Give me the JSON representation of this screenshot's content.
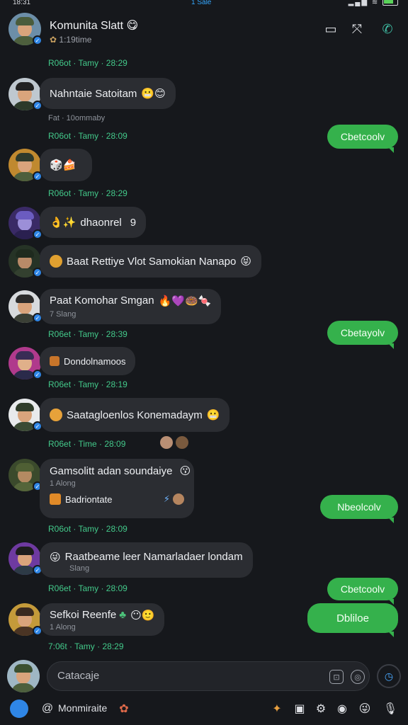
{
  "status_bar": {
    "time": "18:31",
    "center": "1 Sale"
  },
  "header": {
    "title": "Komunita Slatt",
    "title_emoji": "😋",
    "subtitle": "1:19time"
  },
  "messages": [
    {
      "meta": "R06ot · Tamy · 28:29"
    },
    {
      "text": "Nahntaie Satoitam",
      "emoji": "😬😊",
      "sub": "Fat · 10ommaby",
      "meta": "R06ot · Tamy · 28:09"
    },
    {
      "text": "",
      "emoji": "🎲🍰",
      "meta": "R06ot · Tamy · 28:29"
    },
    {
      "text": "dhaonrel",
      "emoji": "👌✨",
      "trail": "9"
    },
    {
      "text": "Baat Rettiye Vlot Samokian Nanapo",
      "emoji": "😝"
    },
    {
      "text": "Paat Komohar Smgan",
      "emoji": "🔥💜🍩🍬",
      "sub": "7 Slang",
      "meta": "R06et · Tamy · 28:39"
    },
    {
      "text": "Dondolnamoos",
      "meta": "R06et · Tamy · 28:19"
    },
    {
      "text": "Saatagloenlos Konemadaym",
      "emoji": "😬",
      "meta": "R06et · Time · 28:09"
    },
    {
      "text": "Gamsolitt adan soundaiye",
      "emoji": "😗",
      "sub": "1 Along",
      "line2": "Badriontate",
      "meta": "R06ot · Tamy · 28:09"
    },
    {
      "text": "Raatbeame leer Namarladaer londam",
      "emoji": "😜",
      "sub": "Slang",
      "meta": "R06et · Tamy · 28:09"
    },
    {
      "text": "Sefkoi Reenfe",
      "emoji": "😶🙂",
      "sub": "1 Along",
      "meta": "7:06t · Tamy · 28:29"
    }
  ],
  "outgoing": [
    {
      "text": "Cbetcoolv"
    },
    {
      "text": "Cbetayolv"
    },
    {
      "text": "Nbeolcolv"
    },
    {
      "text": "Cbetcoolv"
    },
    {
      "text": "Dbliloe"
    }
  ],
  "composer": {
    "placeholder": "Catacaje"
  },
  "bottom": {
    "label": "Monmiraite"
  }
}
